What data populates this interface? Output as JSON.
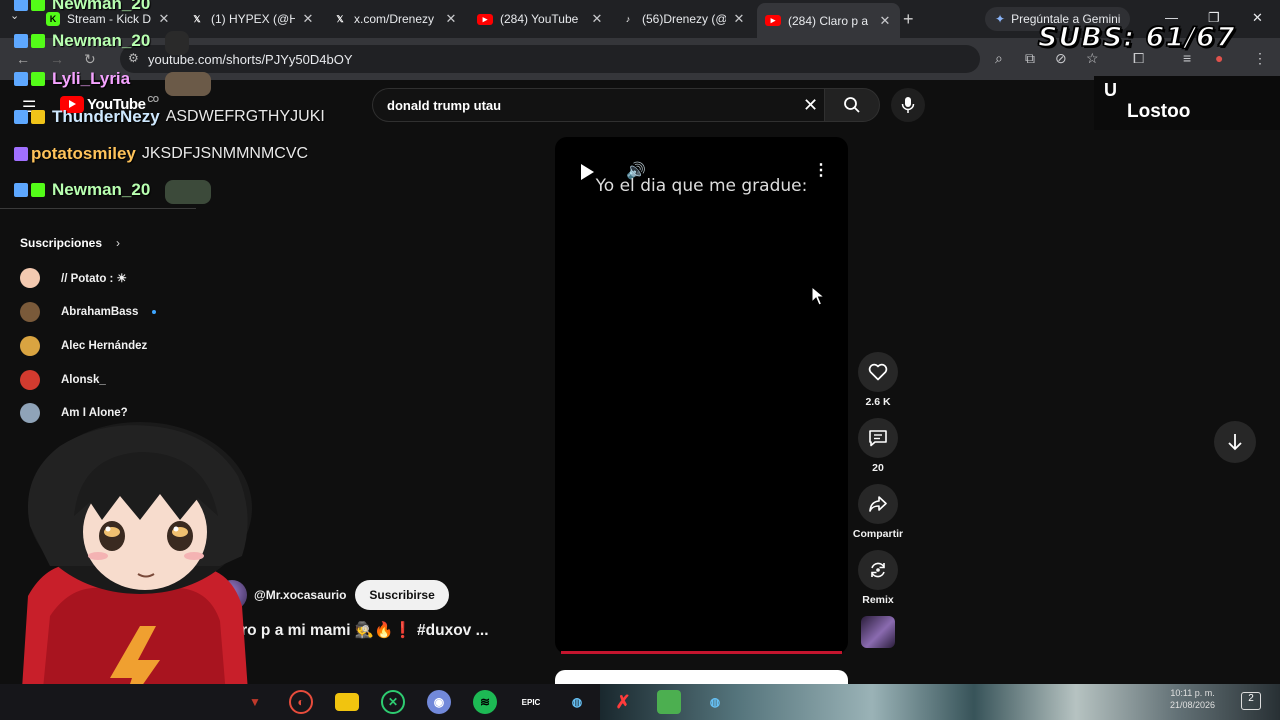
{
  "browser": {
    "tabs": [
      {
        "label": "Stream - Kick D",
        "icon": "kick-icon",
        "color": "#53fc18"
      },
      {
        "label": "(1) HYPEX (@H",
        "icon": "x-icon",
        "color": "#ffffff"
      },
      {
        "label": "x.com/Drenezy",
        "icon": "x-icon",
        "color": "#ffffff"
      },
      {
        "label": "(284) YouTube",
        "icon": "youtube-icon",
        "color": "#ff0000"
      },
      {
        "label": "(56)Drenezy (@",
        "icon": "tiktok-icon",
        "color": "#ffffff"
      },
      {
        "label": "(284) Claro p a",
        "icon": "youtube-icon",
        "color": "#ff0000"
      }
    ],
    "gemini_label": "Pregúntale a Gemini",
    "url": "youtube.com/shorts/PJYy50D4bOY"
  },
  "overlay": {
    "subs_text": "SUBS: 61/67"
  },
  "chat": [
    {
      "user": "Newman_20",
      "message": "",
      "color": "#b8ffb0"
    },
    {
      "user": "Newman_20",
      "message": "",
      "color": "#b8ffb0"
    },
    {
      "user": "Lyli_Lyria",
      "message": "",
      "color": "#f5a3ff"
    },
    {
      "user": "ThunderNezy",
      "message": "ASDWEFRGTHYJUKI",
      "color": "#cfe9ff"
    },
    {
      "user": "potatosmiley",
      "message": "JKSDFJSNMMNMCVC",
      "color": "#ffc35a"
    },
    {
      "user": "Newman_20",
      "message": "",
      "color": "#b8ffb0"
    }
  ],
  "youtube": {
    "logo_text": "YouTube",
    "logo_sup": "CO",
    "search_value": "donald trump utau",
    "lostoo_name": "Lostoo",
    "lostoo_mark": "U"
  },
  "sidebar": {
    "title": "Suscripciones",
    "items": [
      {
        "label": "// Potato : ☀",
        "avatar_color": "#f3c9b0",
        "new": false
      },
      {
        "label": "AbrahamBass",
        "avatar_color": "#7a5a3a",
        "new": true
      },
      {
        "label": "Alec Hernández",
        "avatar_color": "#d9a441",
        "new": false
      },
      {
        "label": "Alonsk_",
        "avatar_color": "#d23b2f",
        "new": false
      },
      {
        "label": "Am I Alone?",
        "avatar_color": "#8fa3b8",
        "new": false
      }
    ]
  },
  "short": {
    "caption": "Yo el dia que me gradue:",
    "channel": "@Mr.xocasaurio",
    "subscribe_label": "Suscribirse",
    "title": "Claro p a mi mami 🕵️🔥❗ #duxov ...",
    "actions": {
      "likes": "2.6 K",
      "comments": "20",
      "share_label": "Compartir",
      "remix_label": "Remix"
    }
  },
  "taskbar": {
    "apps": [
      {
        "icon": "game-launcher-icon",
        "color": "#c0392b"
      },
      {
        "icon": "obs-icon",
        "color": "#e74c3c"
      },
      {
        "icon": "folder-icon",
        "color": "#f1c40f"
      },
      {
        "icon": "xbox-icon",
        "color": "#2ecc71"
      },
      {
        "icon": "discord-icon",
        "color": "#7289da"
      },
      {
        "icon": "spotify-icon",
        "color": "#1db954"
      },
      {
        "icon": "epic-games-icon",
        "color": "#ffffff"
      },
      {
        "icon": "steam-icon",
        "color": "#66c0f4"
      },
      {
        "icon": "x-app-icon",
        "color": "#ff3b3b"
      },
      {
        "icon": "minecraft-icon",
        "color": "#4caf50"
      },
      {
        "icon": "steam-icon",
        "color": "#66c0f4"
      }
    ],
    "epic_label": "EPIC",
    "time": "10:11 p. m.",
    "date": "21/08/2026",
    "notifications": "2"
  }
}
